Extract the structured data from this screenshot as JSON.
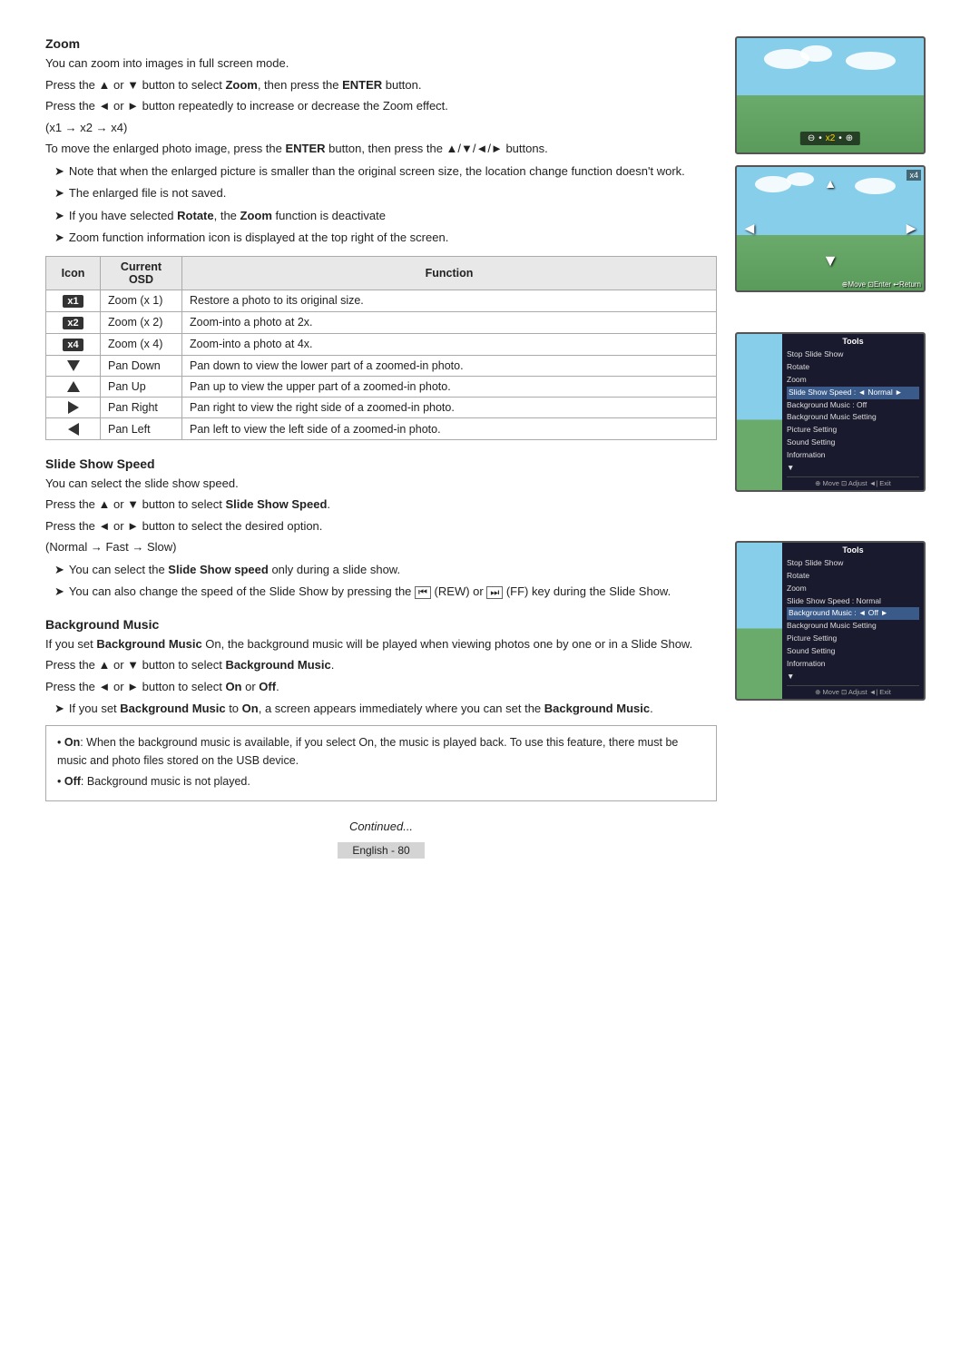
{
  "page": {
    "number": "English - 80"
  },
  "zoom_section": {
    "title": "Zoom",
    "paragraphs": [
      "You can zoom into images in full screen mode.",
      "Press the ▲ or ▼ button to select Zoom, then press the ENTER button.",
      "Press the ◄ or ► button repeatedly to increase or decrease the Zoom effect.",
      "(x1 → x2 → x4)",
      "To move the enlarged photo image, press the ENTER button, then press the ▲/▼/◄/► buttons."
    ],
    "notes": [
      "Note that when the enlarged picture is smaller than the original screen size, the location change function doesn't work.",
      "The enlarged file is not saved.",
      "If you have selected Rotate, the Zoom function is deactivate",
      "Zoom function information icon is displayed at the top right of the screen."
    ],
    "table": {
      "headers": [
        "Icon",
        "Current OSD",
        "Function"
      ],
      "rows": [
        {
          "icon": "x1",
          "icon_type": "badge",
          "osd": "Zoom (x 1)",
          "function": "Restore a photo to its original size."
        },
        {
          "icon": "x2",
          "icon_type": "badge",
          "osd": "Zoom (x 2)",
          "function": "Zoom-into a photo at 2x."
        },
        {
          "icon": "x4",
          "icon_type": "badge",
          "osd": "Zoom (x 4)",
          "function": "Zoom-into a photo at 4x."
        },
        {
          "icon": "▼",
          "icon_type": "triangle-down",
          "osd": "Pan Down",
          "function": "Pan down to view the lower part of a zoomed-in photo."
        },
        {
          "icon": "▲",
          "icon_type": "triangle-up",
          "osd": "Pan Up",
          "function": "Pan up to view the upper part of a zoomed-in photo."
        },
        {
          "icon": "►",
          "icon_type": "triangle-right",
          "osd": "Pan Right",
          "function": "Pan right to view the right side of a zoomed-in photo."
        },
        {
          "icon": "◄",
          "icon_type": "triangle-left",
          "osd": "Pan Left",
          "function": "Pan left to view the left side of a zoomed-in photo."
        }
      ]
    }
  },
  "slide_show_section": {
    "title": "Slide Show Speed",
    "paragraphs": [
      "You can select the slide show speed.",
      "Press the ▲ or ▼ button to select Slide Show Speed.",
      "Press the ◄ or ► button to select the desired option.",
      "(Normal → Fast → Slow)"
    ],
    "notes": [
      "You can select the Slide Show speed only during a slide show.",
      "You can also change the speed of the Slide Show by pressing the [REW] (REW) or [FF] (FF) key during the Slide Show."
    ]
  },
  "background_music_section": {
    "title": "Background Music",
    "paragraphs": [
      "If you set Background Music On, the background music will be played when viewing photos one by one or in a Slide Show.",
      "Press the ▲ or ▼ button to select Background Music.",
      "Press the ◄ or ► button to select On or Off."
    ],
    "notes": [
      "If you set Background Music to On, a screen appears immediately where you can set the Background Music."
    ],
    "info_box": {
      "items": [
        "On: When the background music is available, if you select On, the music is played back. To use this feature, there must be music and photo files stored on the USB device.",
        "Off: Background music is not played."
      ]
    }
  },
  "tools_panel_1": {
    "title": "Tools",
    "items": [
      "Stop Slide Show",
      "Rotate",
      "Zoom",
      "Slide Show Speed :  ◄ Normal ►",
      "Background Music :    Off",
      "Background Music Setting",
      "Picture Setting",
      "Sound Setting",
      "Information",
      "▼"
    ],
    "footer": "⊕ Move  ⊡ Adjust  ◄| Exit",
    "selected_item": "Slide Show Speed :  ◄ Normal ►"
  },
  "tools_panel_2": {
    "title": "Tools",
    "items": [
      "Stop Slide Show",
      "Rotate",
      "Zoom",
      "Slide Show Speed :   Normal",
      "Background Music : ◄ Off ►",
      "Background Music Setting",
      "Picture Setting",
      "Sound Setting",
      "Information",
      "▼"
    ],
    "footer": "⊕ Move  ⊡ Adjust  ◄| Exit",
    "selected_item": "Background Music : ◄ Off ►"
  },
  "continued": "Continued...",
  "zoom_screen": {
    "bar_text": "⊖ • x2 • ⊕"
  },
  "nav_screen": {
    "x4_label": "x4",
    "nav_label": "⊕Move ⊡Enter ↩Return"
  }
}
